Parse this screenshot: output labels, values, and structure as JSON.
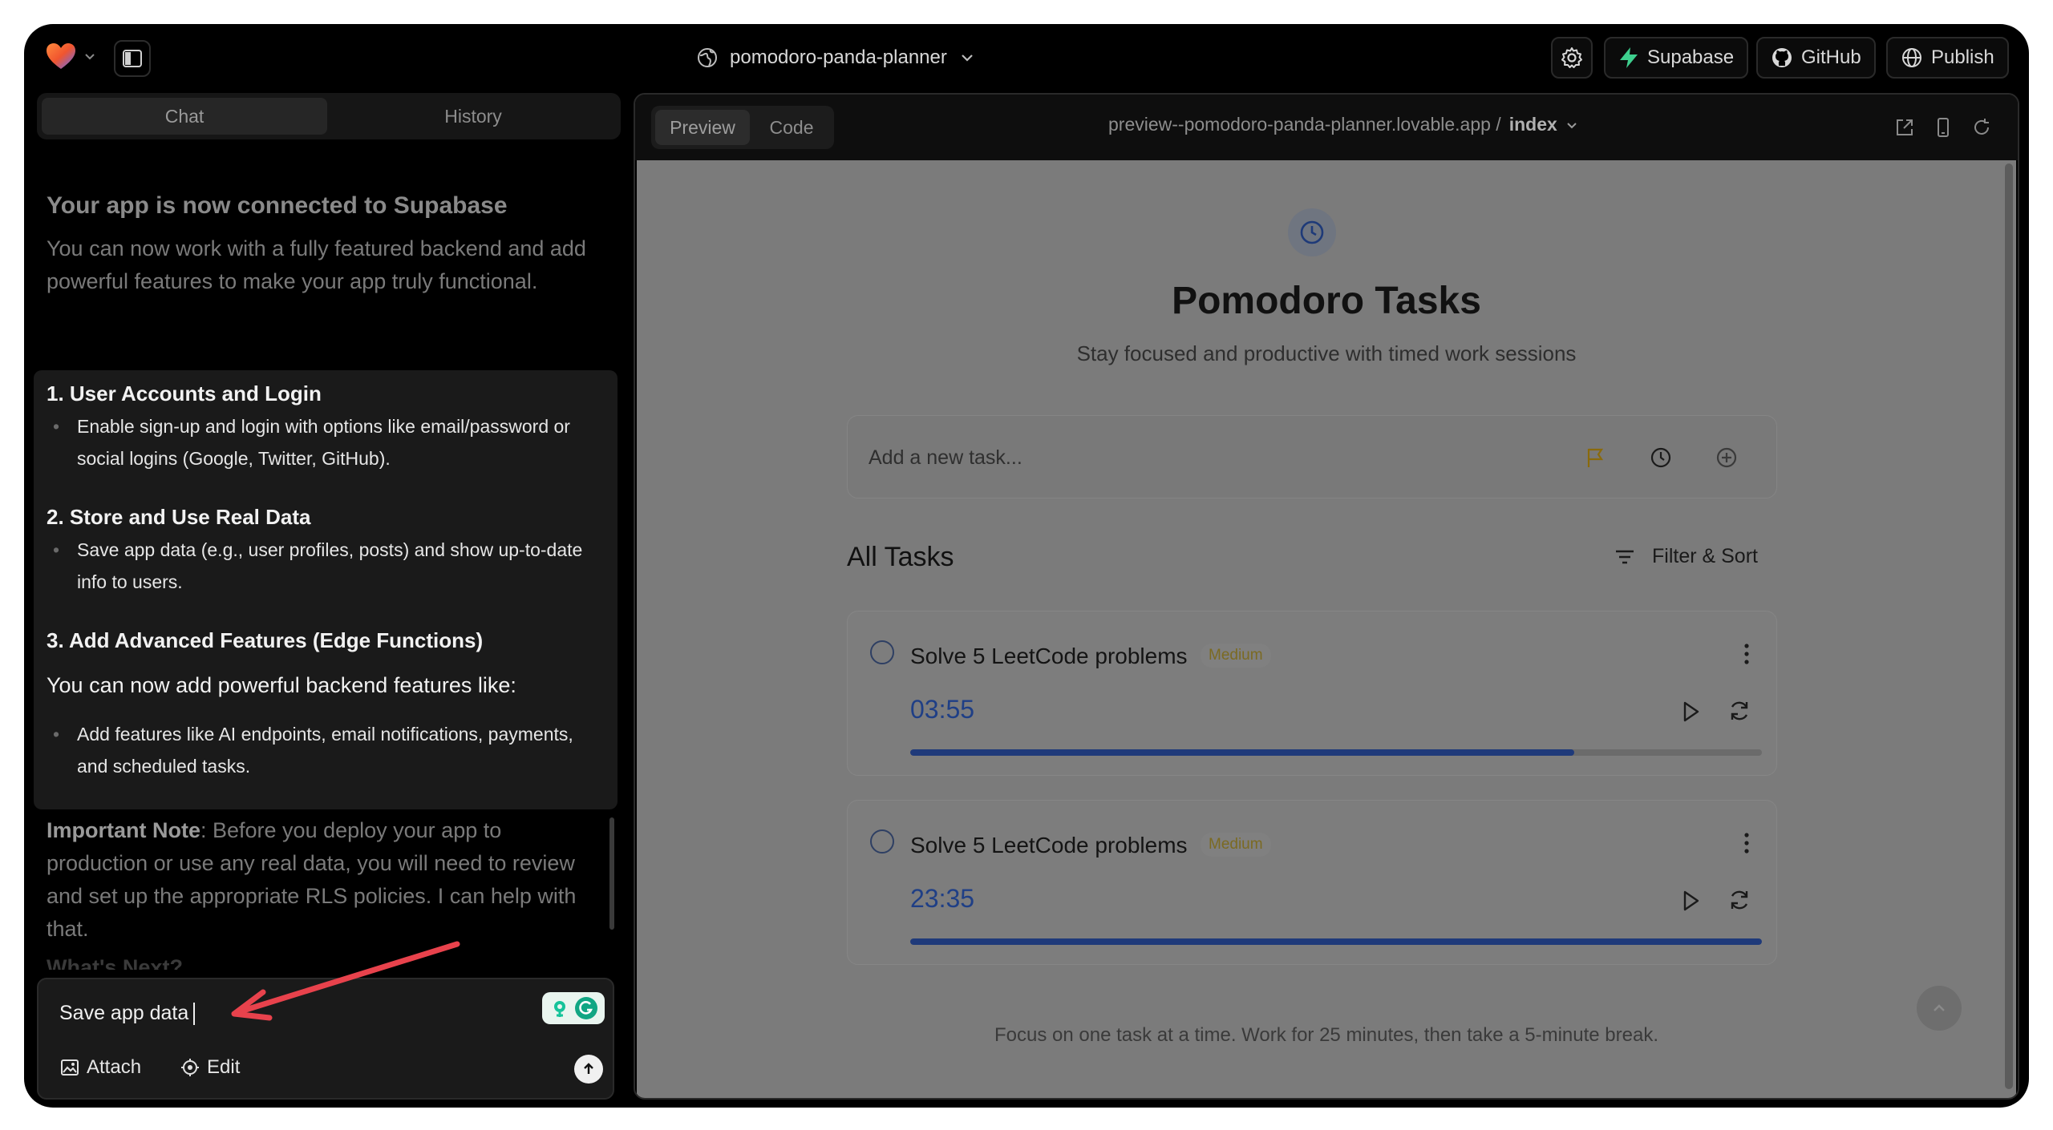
{
  "topbar": {
    "project_name": "pomodoro-panda-planner",
    "buttons": {
      "supabase": "Supabase",
      "github": "GitHub",
      "publish": "Publish"
    }
  },
  "left_tabs": {
    "chat": "Chat",
    "history": "History"
  },
  "chat": {
    "heading": "Your app is now connected to Supabase",
    "intro": "You can now work with a fully featured backend and add powerful features to make your app truly functional.",
    "sections": [
      {
        "title": "1. User Accounts and Login",
        "bullet": "Enable sign-up and login with options like email/password or social logins (Google, Twitter, GitHub)."
      },
      {
        "title": "2. Store and Use Real Data",
        "bullet": "Save app data (e.g., user profiles, posts) and show up-to-date info to users."
      },
      {
        "title": "3. Add Advanced Features (Edge Functions)",
        "lead": "You can now add powerful backend features like:",
        "bullet": "Add features like AI endpoints, email notifications, payments, and scheduled tasks."
      }
    ],
    "note_label": "Important Note",
    "note_text": ": Before you deploy your app to production or use any real data, you will need to review and set up the appropriate RLS policies. I can help with that.",
    "next_heading": "What's Next?"
  },
  "composer": {
    "text": "Save app data",
    "attach": "Attach",
    "edit": "Edit"
  },
  "preview": {
    "tabs": {
      "preview": "Preview",
      "code": "Code"
    },
    "url": "preview--pomodoro-panda-planner.lovable.app /",
    "route": "index"
  },
  "app": {
    "title": "Pomodoro Tasks",
    "subtitle": "Stay focused and productive with timed work sessions",
    "new_task_placeholder": "Add a new task...",
    "section_title": "All Tasks",
    "filter_label": "Filter & Sort",
    "tasks": [
      {
        "title": "Solve 5 LeetCode problems",
        "priority": "Medium",
        "time": "03:55",
        "progress": 0.78
      },
      {
        "title": "Solve 5 LeetCode problems",
        "priority": "Medium",
        "time": "23:35",
        "progress": 1.0
      }
    ],
    "footer": "Focus on one task at a time. Work for 25 minutes, then take a 5-minute break."
  },
  "colors": {
    "accent_time": "#1f3f86",
    "progress_fill": "#1f3a7a",
    "priority_text": "#7b6a22",
    "supabase_green": "#3ecf8e",
    "annotation_arrow": "#e8424c"
  },
  "icons": [
    "heart-logo-icon",
    "sidebar-toggle-icon",
    "globe-icon",
    "chevron-down-icon",
    "gear-icon",
    "bolt-icon",
    "github-icon",
    "clock-icon",
    "flag-icon",
    "plus-circle-icon",
    "filter-icon",
    "more-vertical-icon",
    "play-icon",
    "refresh-icon",
    "image-icon",
    "target-icon",
    "arrow-up-icon",
    "external-link-icon",
    "phone-icon",
    "reload-icon"
  ]
}
